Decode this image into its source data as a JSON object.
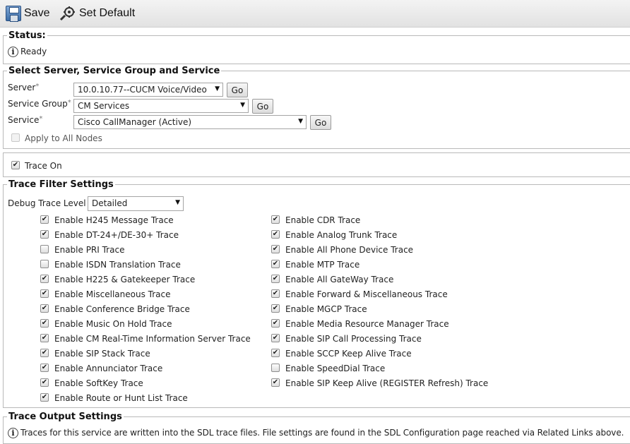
{
  "toolbar": {
    "save_label": "Save",
    "set_default_label": "Set Default"
  },
  "status": {
    "legend": "Status:",
    "text": "Ready"
  },
  "select_section": {
    "legend": "Select Server, Service Group and Service",
    "server_label": "Server",
    "server_value": "10.0.10.77--CUCM Voice/Video",
    "group_label": "Service Group",
    "group_value": "CM Services",
    "service_label": "Service",
    "service_value": "Cisco CallManager (Active)",
    "required_mark": "*",
    "go_label": "Go",
    "apply_all_label": "Apply to All Nodes",
    "apply_all_checked": false
  },
  "trace_on": {
    "label": "Trace On",
    "checked": true
  },
  "filter": {
    "legend": "Trace Filter Settings",
    "debug_label": "Debug Trace Level",
    "debug_value": "Detailed",
    "left": [
      {
        "label": "Enable H245 Message Trace",
        "checked": true
      },
      {
        "label": "Enable DT-24+/DE-30+ Trace",
        "checked": true
      },
      {
        "label": "Enable PRI Trace",
        "checked": false
      },
      {
        "label": "Enable ISDN Translation Trace",
        "checked": false
      },
      {
        "label": "Enable H225 & Gatekeeper Trace",
        "checked": true
      },
      {
        "label": "Enable Miscellaneous Trace",
        "checked": true
      },
      {
        "label": "Enable Conference Bridge Trace",
        "checked": true
      },
      {
        "label": "Enable Music On Hold Trace",
        "checked": true
      },
      {
        "label": "Enable CM Real-Time Information Server Trace",
        "checked": true
      },
      {
        "label": "Enable SIP Stack Trace",
        "checked": true
      },
      {
        "label": "Enable Annunciator Trace",
        "checked": true
      },
      {
        "label": "Enable SoftKey Trace",
        "checked": true
      },
      {
        "label": "Enable Route or Hunt List Trace",
        "checked": true
      }
    ],
    "right": [
      {
        "label": "Enable CDR Trace",
        "checked": true
      },
      {
        "label": "Enable Analog Trunk Trace",
        "checked": true
      },
      {
        "label": "Enable All Phone Device Trace",
        "checked": true
      },
      {
        "label": "Enable MTP Trace",
        "checked": true
      },
      {
        "label": "Enable All GateWay Trace",
        "checked": true
      },
      {
        "label": "Enable Forward & Miscellaneous Trace",
        "checked": true
      },
      {
        "label": "Enable MGCP Trace",
        "checked": true
      },
      {
        "label": "Enable Media Resource Manager Trace",
        "checked": true
      },
      {
        "label": "Enable SIP Call Processing Trace",
        "checked": true
      },
      {
        "label": "Enable SCCP Keep Alive Trace",
        "checked": true
      },
      {
        "label": "Enable SpeedDial Trace",
        "checked": false
      },
      {
        "label": "Enable SIP Keep Alive (REGISTER Refresh) Trace",
        "checked": true
      }
    ]
  },
  "output": {
    "legend": "Trace Output Settings",
    "info_text": "Traces for this service are written into the SDL trace files. File settings are found in the SDL Configuration page reached via Related Links above."
  }
}
